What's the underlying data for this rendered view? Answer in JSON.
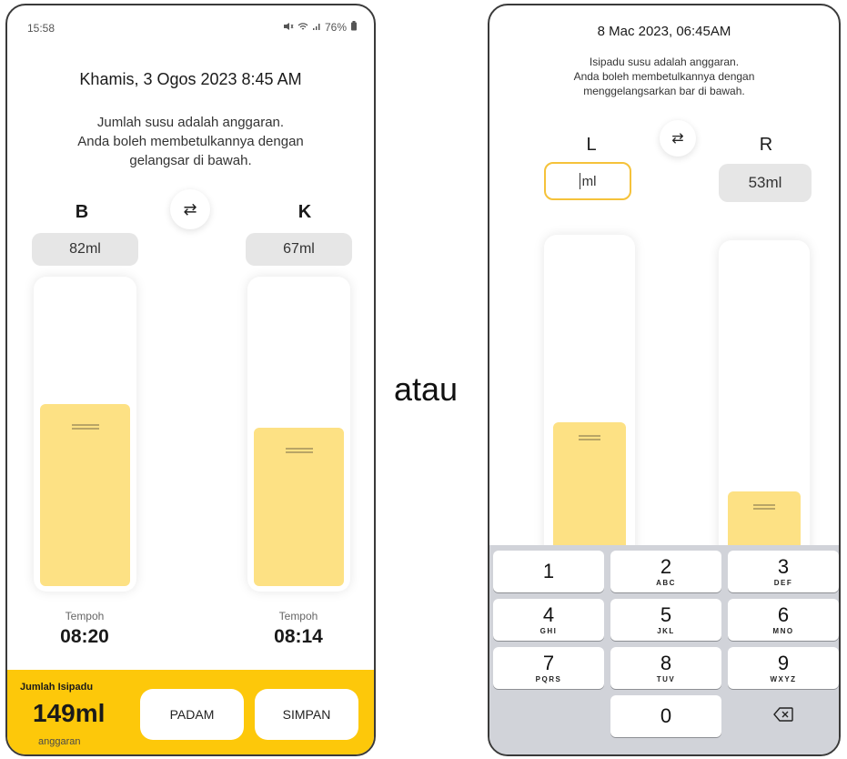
{
  "left_screen": {
    "status": {
      "time": "15:58",
      "battery": "76%"
    },
    "date_title": "Khamis, 3 Ogos 2023 8:45 AM",
    "info_line1": "Jumlah susu adalah anggaran.",
    "info_line2": "Anda boleh membetulkannya dengan",
    "info_line3": "gelangsar di bawah.",
    "left_side": {
      "label": "B",
      "amount": "82ml",
      "duration_label": "Tempoh",
      "duration": "08:20",
      "fill_fraction": 0.6
    },
    "right_side": {
      "label": "K",
      "amount": "67ml",
      "duration_label": "Tempoh",
      "duration": "08:14",
      "fill_fraction": 0.52
    },
    "total": {
      "title": "Jumlah Isipadu",
      "value": "149ml",
      "subtitle": "anggaran"
    },
    "buttons": {
      "delete": "PADAM",
      "save": "SIMPAN"
    }
  },
  "connector_text": "atau",
  "right_screen": {
    "date_title": "8 Mac 2023, 06:45AM",
    "info_line1": "Isipadu susu adalah anggaran.",
    "info_line2": "Anda boleh membetulkannya dengan",
    "info_line3": "menggelangsarkan bar di bawah.",
    "left_side": {
      "label": "L",
      "input_unit": "ml",
      "fill_fraction": 0.5
    },
    "right_side": {
      "label": "R",
      "amount": "53ml",
      "fill_fraction": 0.31
    },
    "keypad": [
      {
        "digit": "1",
        "letters": ""
      },
      {
        "digit": "2",
        "letters": "ABC"
      },
      {
        "digit": "3",
        "letters": "DEF"
      },
      {
        "digit": "4",
        "letters": "GHI"
      },
      {
        "digit": "5",
        "letters": "JKL"
      },
      {
        "digit": "6",
        "letters": "MNO"
      },
      {
        "digit": "7",
        "letters": "PQRS"
      },
      {
        "digit": "8",
        "letters": "TUV"
      },
      {
        "digit": "9",
        "letters": "WXYZ"
      },
      {
        "digit": "0",
        "letters": ""
      }
    ]
  },
  "colors": {
    "accent_yellow": "#fdc80a",
    "fill_yellow": "#fde184",
    "input_border": "#f5c23a"
  }
}
